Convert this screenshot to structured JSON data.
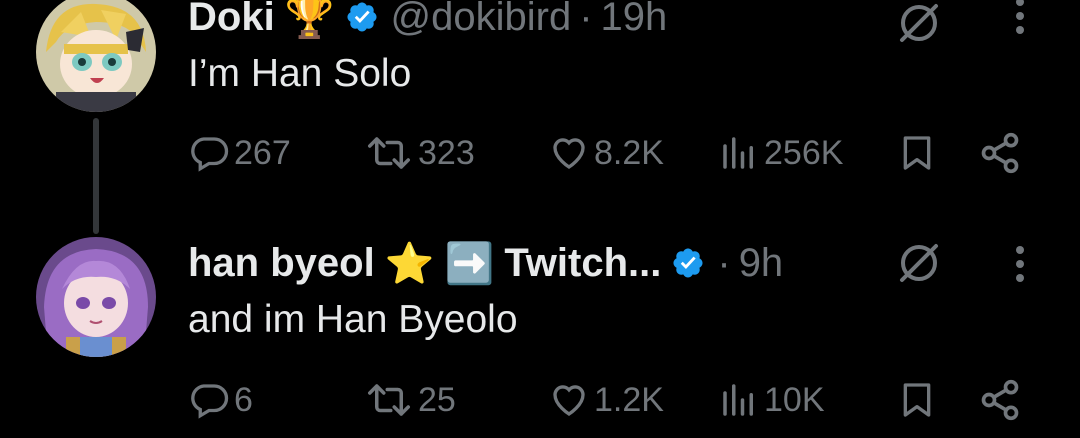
{
  "tweets": [
    {
      "name": "Doki",
      "emoji": "🏆",
      "handle": "@dokibird",
      "separator": "·",
      "time": "19h",
      "text": "I’m Han Solo",
      "replies": "267",
      "reposts": "323",
      "likes": "8.2K",
      "views": "256K"
    },
    {
      "name": "han byeol",
      "emoji": "⭐",
      "emoji2": "➡️",
      "name2": "Twitch...",
      "separator": "·",
      "time": "9h",
      "text": "and im Han Byeolo",
      "replies": "6",
      "reposts": "25",
      "likes": "1.2K",
      "views": "10K"
    }
  ],
  "icons": {
    "reply": "reply-icon",
    "repost": "repost-icon",
    "like": "heart-icon",
    "views": "views-icon",
    "bookmark": "bookmark-icon",
    "share": "share-icon",
    "grok": "grok-icon",
    "more": "more-icon",
    "verified": "verified-badge-icon"
  },
  "colors": {
    "background": "#000000",
    "text": "#e7e9ea",
    "muted": "#71767b",
    "verified": "#1d9bf0"
  }
}
